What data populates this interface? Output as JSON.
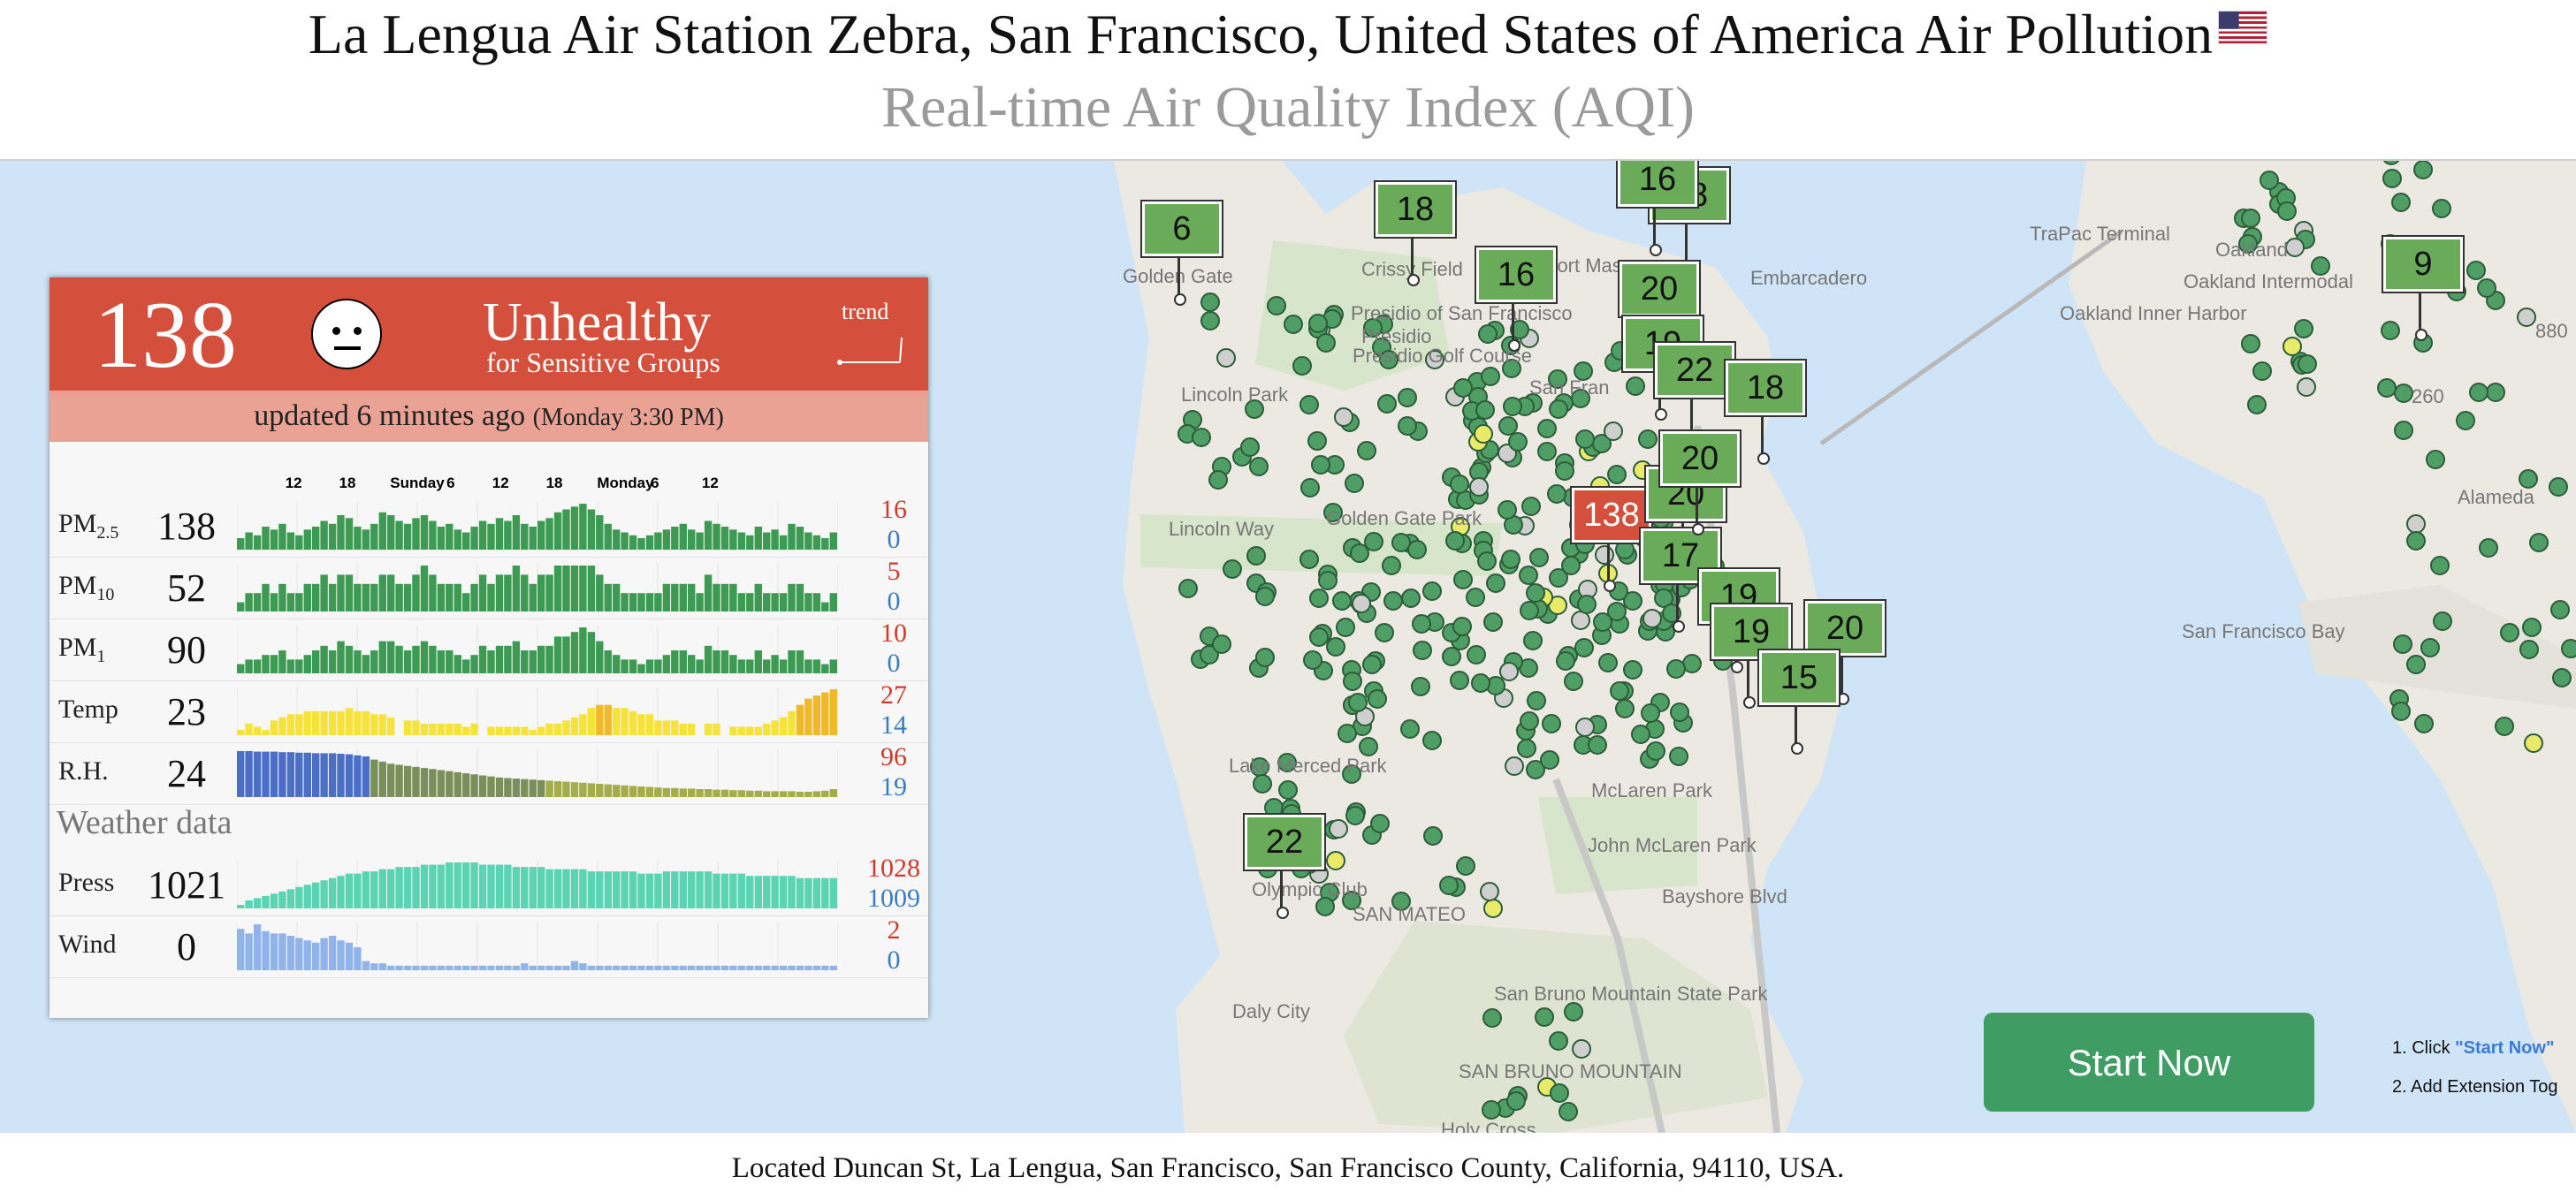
{
  "header": {
    "title": "La Lengua Air Station Zebra, San Francisco, United States of America Air Pollution",
    "subtitle": "Real-time Air Quality Index (AQI)"
  },
  "colors": {
    "unhealthy_sg": "#d4503c",
    "good": "#6aab5a",
    "dot_green": "#4f9e65"
  },
  "card": {
    "aqi": "138",
    "level": "Unhealthy",
    "level_sub": "for Sensitive Groups",
    "trend_label": "trend",
    "updated": "updated 6 minutes ago",
    "updated_time": "(Monday 3:30 PM)",
    "time_ticks": [
      "12",
      "18",
      "Sunday",
      "6",
      "12",
      "18",
      "Monday",
      "6",
      "12"
    ],
    "rows": [
      {
        "name": "PM",
        "sub": "2.5",
        "value": "138",
        "max": "16",
        "min": "0",
        "color": "#3c9a52",
        "values": [
          4,
          6,
          5,
          8,
          7,
          9,
          6,
          5,
          7,
          8,
          10,
          9,
          12,
          11,
          8,
          7,
          9,
          13,
          12,
          10,
          9,
          11,
          12,
          10,
          8,
          9,
          7,
          6,
          8,
          10,
          9,
          11,
          10,
          12,
          9,
          8,
          10,
          11,
          13,
          14,
          15,
          16,
          14,
          12,
          9,
          7,
          6,
          5,
          4,
          5,
          6,
          7,
          8,
          9,
          7,
          6,
          10,
          9,
          8,
          7,
          6,
          5,
          8,
          6,
          7,
          5,
          9,
          8,
          6,
          5,
          4,
          6
        ]
      },
      {
        "name": "PM",
        "sub": "10",
        "value": "52",
        "max": "5",
        "min": "0",
        "color": "#3c9a52",
        "values": [
          1,
          2,
          2,
          3,
          2,
          3,
          2,
          2,
          3,
          3,
          4,
          3,
          4,
          4,
          3,
          3,
          3,
          4,
          4,
          3,
          3,
          4,
          5,
          4,
          3,
          3,
          3,
          2,
          3,
          4,
          3,
          4,
          4,
          5,
          4,
          3,
          4,
          4,
          5,
          5,
          5,
          5,
          5,
          4,
          3,
          3,
          2,
          2,
          2,
          2,
          2,
          3,
          3,
          3,
          3,
          2,
          4,
          3,
          3,
          3,
          2,
          2,
          3,
          2,
          2,
          2,
          3,
          3,
          2,
          2,
          1,
          2
        ]
      },
      {
        "name": "PM",
        "sub": "1",
        "value": "90",
        "max": "10",
        "min": "0",
        "color": "#3c9a52",
        "values": [
          2,
          3,
          3,
          4,
          4,
          5,
          3,
          3,
          4,
          5,
          6,
          5,
          7,
          6,
          5,
          4,
          5,
          7,
          7,
          6,
          5,
          6,
          7,
          6,
          5,
          5,
          4,
          3,
          4,
          6,
          5,
          6,
          6,
          7,
          5,
          5,
          6,
          6,
          8,
          8,
          9,
          10,
          9,
          7,
          5,
          4,
          3,
          3,
          2,
          3,
          3,
          4,
          5,
          5,
          4,
          3,
          6,
          5,
          5,
          4,
          3,
          3,
          5,
          3,
          4,
          3,
          5,
          5,
          3,
          3,
          2,
          3
        ]
      },
      {
        "name": "Temp",
        "sub": "",
        "value": "23",
        "max": "27",
        "min": "14",
        "color": "#f5dd2e",
        "values": [
          14,
          16,
          15,
          14,
          17,
          18,
          19,
          19,
          20,
          20,
          20,
          20,
          20,
          21,
          20,
          20,
          19,
          19,
          18,
          0,
          17,
          17,
          16,
          16,
          16,
          16,
          16,
          15,
          16,
          0,
          15,
          15,
          15,
          15,
          15,
          14,
          15,
          16,
          16,
          17,
          18,
          19,
          21,
          22,
          22,
          21,
          21,
          20,
          19,
          19,
          17,
          17,
          17,
          16,
          16,
          0,
          16,
          16,
          0,
          15,
          15,
          15,
          15,
          16,
          17,
          18,
          20,
          22,
          24,
          25,
          26,
          27
        ]
      },
      {
        "name": "R.H.",
        "sub": "",
        "value": "24",
        "max": "96",
        "min": "19",
        "color": "#5f8a4c",
        "values": [
          96,
          96,
          95,
          95,
          95,
          94,
          94,
          93,
          93,
          92,
          92,
          92,
          91,
          90,
          88,
          86,
          80,
          76,
          72,
          70,
          68,
          66,
          64,
          62,
          60,
          58,
          56,
          54,
          52,
          50,
          48,
          46,
          45,
          44,
          43,
          42,
          41,
          40,
          39,
          38,
          37,
          36,
          35,
          34,
          33,
          32,
          31,
          30,
          29,
          28,
          27,
          26,
          26,
          25,
          25,
          24,
          24,
          23,
          23,
          22,
          22,
          21,
          21,
          20,
          20,
          20,
          20,
          19,
          19,
          20,
          21,
          24
        ]
      },
      {
        "name": "Press",
        "sub": "",
        "value": "1021",
        "max": "1028",
        "min": "1009",
        "color": "#5bd4b4",
        "values": [
          1009,
          1011,
          1012,
          1013,
          1014,
          1015,
          1016,
          1017,
          1018,
          1019,
          1020,
          1021,
          1022,
          1023,
          1023,
          1024,
          1024,
          1025,
          1025,
          1026,
          1026,
          1026,
          1027,
          1027,
          1027,
          1028,
          1028,
          1028,
          1028,
          1027,
          1027,
          1027,
          1027,
          1026,
          1026,
          1026,
          1026,
          1025,
          1025,
          1025,
          1025,
          1025,
          1024,
          1024,
          1024,
          1024,
          1024,
          1024,
          1023,
          1023,
          1023,
          1024,
          1024,
          1024,
          1024,
          1024,
          1024,
          1023,
          1023,
          1023,
          1023,
          1022,
          1022,
          1022,
          1022,
          1022,
          1022,
          1021,
          1021,
          1021,
          1021,
          1021
        ]
      },
      {
        "name": "Wind",
        "sub": "",
        "value": "0",
        "max": "2",
        "min": "0",
        "color": "#8fb3ea",
        "values": [
          1.8,
          1.6,
          2.0,
          1.7,
          1.6,
          1.6,
          1.5,
          1.4,
          1.3,
          1.2,
          1.4,
          1.5,
          1.3,
          1.2,
          1.0,
          0.4,
          0.3,
          0.3,
          0.2,
          0.2,
          0.2,
          0.2,
          0.2,
          0.2,
          0.2,
          0.2,
          0.2,
          0.2,
          0.2,
          0.2,
          0.2,
          0.2,
          0.2,
          0.2,
          0.3,
          0.2,
          0.2,
          0.2,
          0.2,
          0.2,
          0.4,
          0.3,
          0.2,
          0.2,
          0.2,
          0.2,
          0.2,
          0.2,
          0.2,
          0.2,
          0.2,
          0.2,
          0.2,
          0.2,
          0.2,
          0.2,
          0.2,
          0.2,
          0.2,
          0.2,
          0.2,
          0.2,
          0.2,
          0.2,
          0.2,
          0.2,
          0.2,
          0.2,
          0.2,
          0.2,
          0.2,
          0.2
        ]
      }
    ],
    "weather_label": "Weather data"
  },
  "map": {
    "labels": [
      "Golden Gate",
      "Crissy Field",
      "Fort Mason",
      "Presidio of San Francisco",
      "Presidio",
      "Presidio Golf Course",
      "Lincoln Park",
      "Lincoln Way",
      "Golden Gate Park",
      "Lake Merced Park",
      "McLaren Park",
      "John McLaren Park",
      "Olympic Club",
      "SAN MATEO",
      "Daly City",
      "San Bruno Mountain State Park",
      "SAN BRUNO MOUNTAIN",
      "Holy Cross",
      "Bayshore Blvd",
      "Embarcadero",
      "TraPac Terminal",
      "Oakland",
      "Oakland Intermodal",
      "Oakland Inner Harbor",
      "Alameda",
      "San Francisco Bay",
      "880",
      "260",
      "San Fran"
    ],
    "markers": [
      {
        "value": "6",
        "color": "#6aab5a"
      },
      {
        "value": "18",
        "color": "#6aab5a"
      },
      {
        "value": "16",
        "color": "#6aab5a"
      },
      {
        "value": "18",
        "color": "#6aab5a"
      },
      {
        "value": "20",
        "color": "#6aab5a"
      },
      {
        "value": "19",
        "color": "#6aab5a"
      },
      {
        "value": "22",
        "color": "#6aab5a"
      },
      {
        "value": "18",
        "color": "#6aab5a"
      },
      {
        "value": "138",
        "color": "#d4503c"
      },
      {
        "value": "20",
        "color": "#6aab5a"
      },
      {
        "value": "17",
        "color": "#6aab5a"
      },
      {
        "value": "19",
        "color": "#6aab5a"
      },
      {
        "value": "19",
        "color": "#6aab5a"
      },
      {
        "value": "20",
        "color": "#6aab5a"
      },
      {
        "value": "15",
        "color": "#6aab5a"
      },
      {
        "value": "22",
        "color": "#6aab5a"
      },
      {
        "value": "9",
        "color": "#6aab5a"
      },
      {
        "value": "16",
        "color": "#6aab5a"
      },
      {
        "value": "20",
        "color": "#6aab5a"
      }
    ]
  },
  "cta": {
    "start_now": "Start Now",
    "step1_prefix": "1. Click ",
    "step1_link": "\"Start Now\"",
    "step2": "2. Add Extension Tog"
  },
  "footer": {
    "location": "Located Duncan St, La Lengua, San Francisco, San Francisco County, California, 94110, USA."
  }
}
